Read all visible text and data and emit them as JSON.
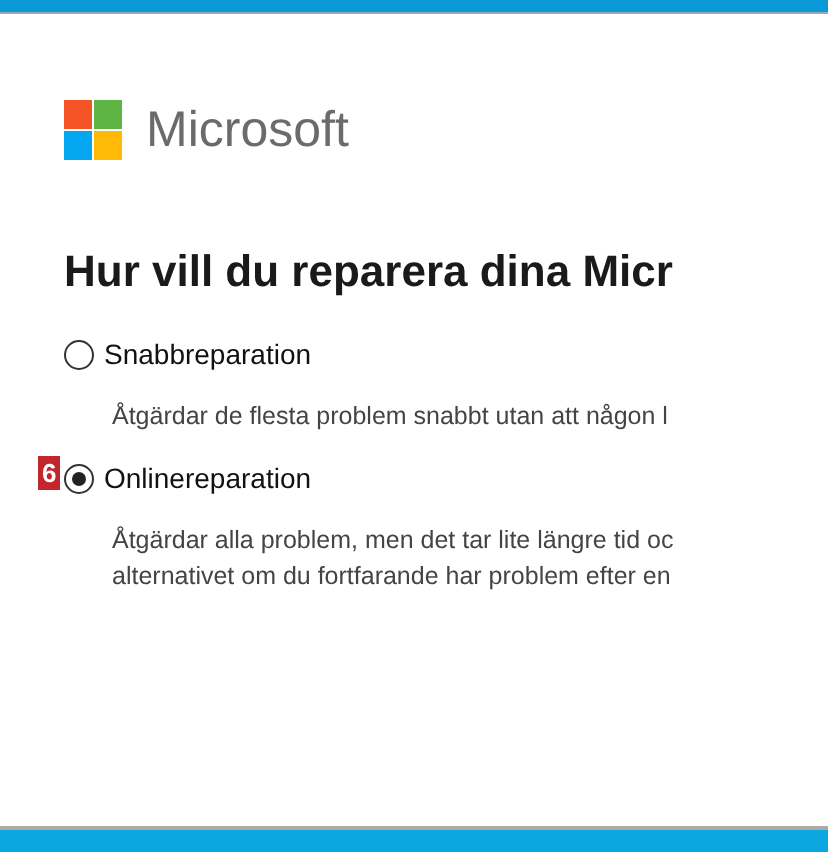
{
  "brand": {
    "name": "Microsoft"
  },
  "heading": "Hur vill du reparera dina Micr",
  "options": [
    {
      "label": "Snabbreparation",
      "selected": false,
      "description": [
        "Åtgärdar de flesta problem snabbt utan att någon l"
      ]
    },
    {
      "label": "Onlinereparation",
      "selected": true,
      "badge": "6",
      "description": [
        "Åtgärdar alla problem, men det tar lite längre tid oc",
        "alternativet om du fortfarande har problem efter en"
      ]
    }
  ]
}
